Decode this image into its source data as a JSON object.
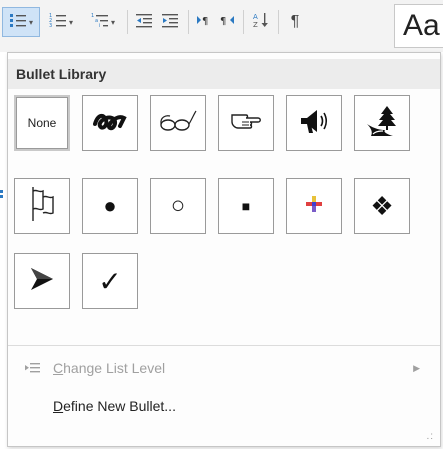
{
  "ribbon": {
    "buttons": [
      {
        "name": "bullets-button",
        "icon": "bullet-list-icon",
        "active": true
      },
      {
        "name": "numbering-button",
        "icon": "numbered-list-icon"
      },
      {
        "name": "multilevel-list-button",
        "icon": "multilevel-list-icon"
      },
      {
        "name": "decrease-indent-button",
        "icon": "decrease-indent-icon"
      },
      {
        "name": "increase-indent-button",
        "icon": "increase-indent-icon"
      },
      {
        "name": "ltr-button",
        "icon": "left-to-right-paragraph-icon"
      },
      {
        "name": "rtl-button",
        "icon": "right-to-left-paragraph-icon"
      },
      {
        "name": "sort-button",
        "icon": "sort-az-icon"
      },
      {
        "name": "show-marks-button",
        "glyph": "¶",
        "icon": "pilcrow-icon"
      }
    ],
    "style_preview": "Aa",
    "dropdown_glyph": "▾"
  },
  "menu": {
    "header": "Bullet Library",
    "bullets": [
      {
        "name": "none",
        "label": "None",
        "icon": "none",
        "selected": true
      },
      {
        "name": "swash-bullet",
        "icon": "swash-icon"
      },
      {
        "name": "glasses-bullet",
        "icon": "glasses-icon"
      },
      {
        "name": "pointing-hand-bullet",
        "icon": "pointing-hand-icon"
      },
      {
        "name": "megaphone-bullet",
        "icon": "megaphone-icon"
      },
      {
        "name": "tree-road-bullet",
        "icon": "tree-road-icon"
      },
      {
        "name": "flag-bullet",
        "icon": "flag-icon"
      },
      {
        "name": "filled-circle-bullet",
        "glyph": "●",
        "icon": "filled-circle-icon"
      },
      {
        "name": "hollow-circle-bullet",
        "glyph": "○",
        "icon": "hollow-circle-icon"
      },
      {
        "name": "square-bullet",
        "glyph": "■",
        "icon": "square-icon"
      },
      {
        "name": "color-cross-bullet",
        "icon": "color-cross-icon"
      },
      {
        "name": "diamond-bullet",
        "glyph": "❖",
        "icon": "four-diamond-icon"
      },
      {
        "name": "arrowhead-bullet",
        "glyph": "➢",
        "icon": "arrowhead-icon"
      },
      {
        "name": "checkmark-bullet",
        "glyph": "✓",
        "icon": "checkmark-icon"
      }
    ],
    "items": [
      {
        "label": "Change List Level",
        "accel": "C",
        "rest": "hange List Level",
        "disabled": true,
        "icon": "change-level-icon",
        "submenu_glyph": "▶"
      },
      {
        "label": "Define New Bullet...",
        "accel": "D",
        "rest": "efine New Bullet...",
        "disabled": false
      }
    ],
    "grip_glyph": ".:"
  },
  "colors": {
    "accent": "#2b79c2",
    "header_bg": "#ececec",
    "disabled_text": "#a0a0a0"
  }
}
